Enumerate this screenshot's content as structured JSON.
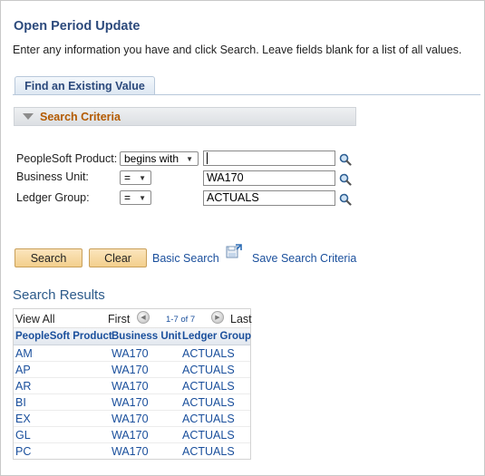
{
  "page": {
    "title": "Open Period Update",
    "instructions": "Enter any information you have and click Search. Leave fields blank for a list of all values."
  },
  "tab": {
    "label": "Find an Existing Value"
  },
  "criteria": {
    "header": "Search Criteria",
    "fields": [
      {
        "label": "PeopleSoft Product:",
        "operator": "begins with",
        "value": "",
        "icon": "magnifier-icon"
      },
      {
        "label": "Business Unit:",
        "operator": "=",
        "value": "WA170",
        "icon": "magnifier-icon"
      },
      {
        "label": "Ledger Group:",
        "operator": "=",
        "value": "ACTUALS",
        "icon": "magnifier-icon"
      }
    ]
  },
  "actions": {
    "search_label": "Search",
    "clear_label": "Clear",
    "basic_search_label": "Basic Search",
    "save_criteria_label": "Save Search Criteria"
  },
  "results": {
    "title": "Search Results",
    "nav": {
      "view_all": "View All",
      "first": "First",
      "range": "1-7 of 7",
      "last": "Last"
    },
    "columns": [
      "PeopleSoft Product",
      "Business Unit",
      "Ledger Group"
    ],
    "rows": [
      [
        "AM",
        "WA170",
        "ACTUALS"
      ],
      [
        "AP",
        "WA170",
        "ACTUALS"
      ],
      [
        "AR",
        "WA170",
        "ACTUALS"
      ],
      [
        "BI",
        "WA170",
        "ACTUALS"
      ],
      [
        "EX",
        "WA170",
        "ACTUALS"
      ],
      [
        "GL",
        "WA170",
        "ACTUALS"
      ],
      [
        "PC",
        "WA170",
        "ACTUALS"
      ]
    ]
  },
  "colors": {
    "title": "#2c4a7c",
    "criteria_header": "#b35a00",
    "link": "#1a4f9c",
    "button": "#f3cf8c"
  }
}
